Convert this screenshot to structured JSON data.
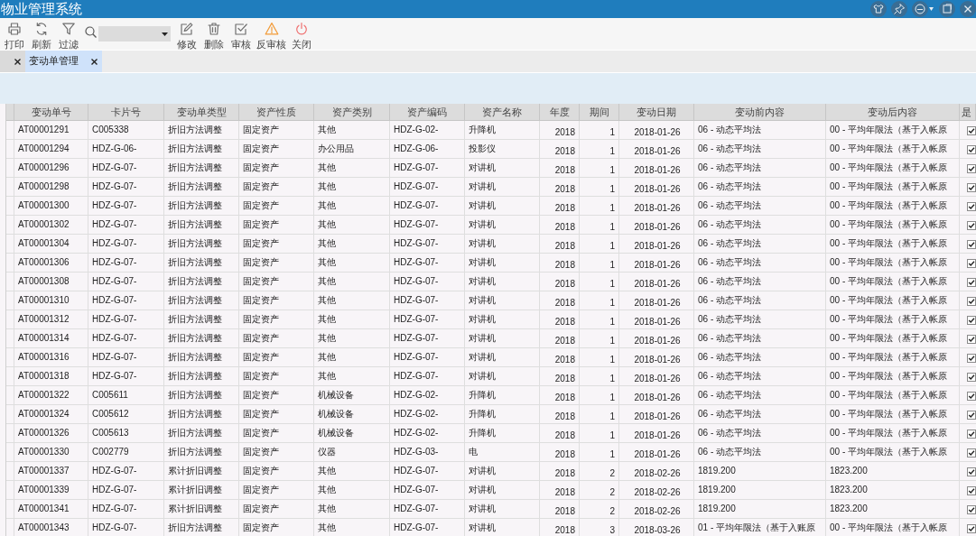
{
  "window": {
    "title": "物业管理系统"
  },
  "toolbar": {
    "items": [
      {
        "kind": "print",
        "label": "打印"
      },
      {
        "kind": "refresh",
        "label": "刷新"
      },
      {
        "kind": "filter",
        "label": "过滤"
      },
      {
        "kind": "search"
      },
      {
        "kind": "edit",
        "label": "修改"
      },
      {
        "kind": "delete",
        "label": "删除"
      },
      {
        "kind": "approve",
        "label": "审核"
      },
      {
        "kind": "unapprove",
        "label": "反审核"
      },
      {
        "kind": "close",
        "label": "关闭"
      }
    ]
  },
  "tabs": [
    {
      "selected": false
    },
    {
      "label": "变动单管理",
      "selected": true
    }
  ],
  "table": {
    "columns": [
      "变动单号",
      "卡片号",
      "变动单类型",
      "资产性质",
      "资产类别",
      "资产编码",
      "资产名称",
      "年度",
      "期间",
      "变动日期",
      "变动前内容",
      "变动后内容",
      "是"
    ],
    "rows": [
      {
        "cells": [
          "AT00001291",
          "C005338",
          "折旧方法调整",
          "固定资产",
          "其他",
          "HDZ-G-02-",
          "升降机",
          "2018",
          "1",
          "2018-01-26",
          "06 - 动态平均法",
          "00 - 平均年限法（基于入帐原"
        ],
        "checked": true
      },
      {
        "cells": [
          "AT00001294",
          "HDZ-G-06-",
          "折旧方法调整",
          "固定资产",
          "办公用品",
          "HDZ-G-06-",
          "投影仪",
          "2018",
          "1",
          "2018-01-26",
          "06 - 动态平均法",
          "00 - 平均年限法（基于入帐原"
        ],
        "checked": true
      },
      {
        "cells": [
          "AT00001296",
          "HDZ-G-07-",
          "折旧方法调整",
          "固定资产",
          "其他",
          "HDZ-G-07-",
          "对讲机",
          "2018",
          "1",
          "2018-01-26",
          "06 - 动态平均法",
          "00 - 平均年限法（基于入帐原"
        ],
        "checked": true
      },
      {
        "cells": [
          "AT00001298",
          "HDZ-G-07-",
          "折旧方法调整",
          "固定资产",
          "其他",
          "HDZ-G-07-",
          "对讲机",
          "2018",
          "1",
          "2018-01-26",
          "06 - 动态平均法",
          "00 - 平均年限法（基于入帐原"
        ],
        "checked": true
      },
      {
        "cells": [
          "AT00001300",
          "HDZ-G-07-",
          "折旧方法调整",
          "固定资产",
          "其他",
          "HDZ-G-07-",
          "对讲机",
          "2018",
          "1",
          "2018-01-26",
          "06 - 动态平均法",
          "00 - 平均年限法（基于入帐原"
        ],
        "checked": true
      },
      {
        "cells": [
          "AT00001302",
          "HDZ-G-07-",
          "折旧方法调整",
          "固定资产",
          "其他",
          "HDZ-G-07-",
          "对讲机",
          "2018",
          "1",
          "2018-01-26",
          "06 - 动态平均法",
          "00 - 平均年限法（基于入帐原"
        ],
        "checked": true
      },
      {
        "cells": [
          "AT00001304",
          "HDZ-G-07-",
          "折旧方法调整",
          "固定资产",
          "其他",
          "HDZ-G-07-",
          "对讲机",
          "2018",
          "1",
          "2018-01-26",
          "06 - 动态平均法",
          "00 - 平均年限法（基于入帐原"
        ],
        "checked": true
      },
      {
        "cells": [
          "AT00001306",
          "HDZ-G-07-",
          "折旧方法调整",
          "固定资产",
          "其他",
          "HDZ-G-07-",
          "对讲机",
          "2018",
          "1",
          "2018-01-26",
          "06 - 动态平均法",
          "00 - 平均年限法（基于入帐原"
        ],
        "checked": true
      },
      {
        "cells": [
          "AT00001308",
          "HDZ-G-07-",
          "折旧方法调整",
          "固定资产",
          "其他",
          "HDZ-G-07-",
          "对讲机",
          "2018",
          "1",
          "2018-01-26",
          "06 - 动态平均法",
          "00 - 平均年限法（基于入帐原"
        ],
        "checked": true
      },
      {
        "cells": [
          "AT00001310",
          "HDZ-G-07-",
          "折旧方法调整",
          "固定资产",
          "其他",
          "HDZ-G-07-",
          "对讲机",
          "2018",
          "1",
          "2018-01-26",
          "06 - 动态平均法",
          "00 - 平均年限法（基于入帐原"
        ],
        "checked": true
      },
      {
        "cells": [
          "AT00001312",
          "HDZ-G-07-",
          "折旧方法调整",
          "固定资产",
          "其他",
          "HDZ-G-07-",
          "对讲机",
          "2018",
          "1",
          "2018-01-26",
          "06 - 动态平均法",
          "00 - 平均年限法（基于入帐原"
        ],
        "checked": true
      },
      {
        "cells": [
          "AT00001314",
          "HDZ-G-07-",
          "折旧方法调整",
          "固定资产",
          "其他",
          "HDZ-G-07-",
          "对讲机",
          "2018",
          "1",
          "2018-01-26",
          "06 - 动态平均法",
          "00 - 平均年限法（基于入帐原"
        ],
        "checked": true
      },
      {
        "cells": [
          "AT00001316",
          "HDZ-G-07-",
          "折旧方法调整",
          "固定资产",
          "其他",
          "HDZ-G-07-",
          "对讲机",
          "2018",
          "1",
          "2018-01-26",
          "06 - 动态平均法",
          "00 - 平均年限法（基于入帐原"
        ],
        "checked": true
      },
      {
        "cells": [
          "AT00001318",
          "HDZ-G-07-",
          "折旧方法调整",
          "固定资产",
          "其他",
          "HDZ-G-07-",
          "对讲机",
          "2018",
          "1",
          "2018-01-26",
          "06 - 动态平均法",
          "00 - 平均年限法（基于入帐原"
        ],
        "checked": true
      },
      {
        "cells": [
          "AT00001322",
          "C005611",
          "折旧方法调整",
          "固定资产",
          "机械设备",
          "HDZ-G-02-",
          "升降机",
          "2018",
          "1",
          "2018-01-26",
          "06 - 动态平均法",
          "00 - 平均年限法（基于入帐原"
        ],
        "checked": true
      },
      {
        "cells": [
          "AT00001324",
          "C005612",
          "折旧方法调整",
          "固定资产",
          "机械设备",
          "HDZ-G-02-",
          "升降机",
          "2018",
          "1",
          "2018-01-26",
          "06 - 动态平均法",
          "00 - 平均年限法（基于入帐原"
        ],
        "checked": true
      },
      {
        "cells": [
          "AT00001326",
          "C005613",
          "折旧方法调整",
          "固定资产",
          "机械设备",
          "HDZ-G-02-",
          "升降机",
          "2018",
          "1",
          "2018-01-26",
          "06 - 动态平均法",
          "00 - 平均年限法（基于入帐原"
        ],
        "checked": true
      },
      {
        "cells": [
          "AT00001330",
          "C002779",
          "折旧方法调整",
          "固定资产",
          "仪器",
          "HDZ-G-03-",
          "电",
          "2018",
          "1",
          "2018-01-26",
          "06 - 动态平均法",
          "00 - 平均年限法（基于入帐原"
        ],
        "checked": true
      },
      {
        "cells": [
          "AT00001337",
          "HDZ-G-07-",
          "累计折旧调整",
          "固定资产",
          "其他",
          "HDZ-G-07-",
          "对讲机",
          "2018",
          "2",
          "2018-02-26",
          "1819.200",
          "1823.200"
        ],
        "checked": true
      },
      {
        "cells": [
          "AT00001339",
          "HDZ-G-07-",
          "累计折旧调整",
          "固定资产",
          "其他",
          "HDZ-G-07-",
          "对讲机",
          "2018",
          "2",
          "2018-02-26",
          "1819.200",
          "1823.200"
        ],
        "checked": true
      },
      {
        "cells": [
          "AT00001341",
          "HDZ-G-07-",
          "累计折旧调整",
          "固定资产",
          "其他",
          "HDZ-G-07-",
          "对讲机",
          "2018",
          "2",
          "2018-02-26",
          "1819.200",
          "1823.200"
        ],
        "checked": true
      },
      {
        "cells": [
          "AT00001343",
          "HDZ-G-07-",
          "折旧方法调整",
          "固定资产",
          "其他",
          "HDZ-G-07-",
          "对讲机",
          "2018",
          "3",
          "2018-03-26",
          "01 - 平均年限法（基于入账原",
          "00 - 平均年限法（基于入帐原"
        ],
        "checked": true
      }
    ]
  }
}
